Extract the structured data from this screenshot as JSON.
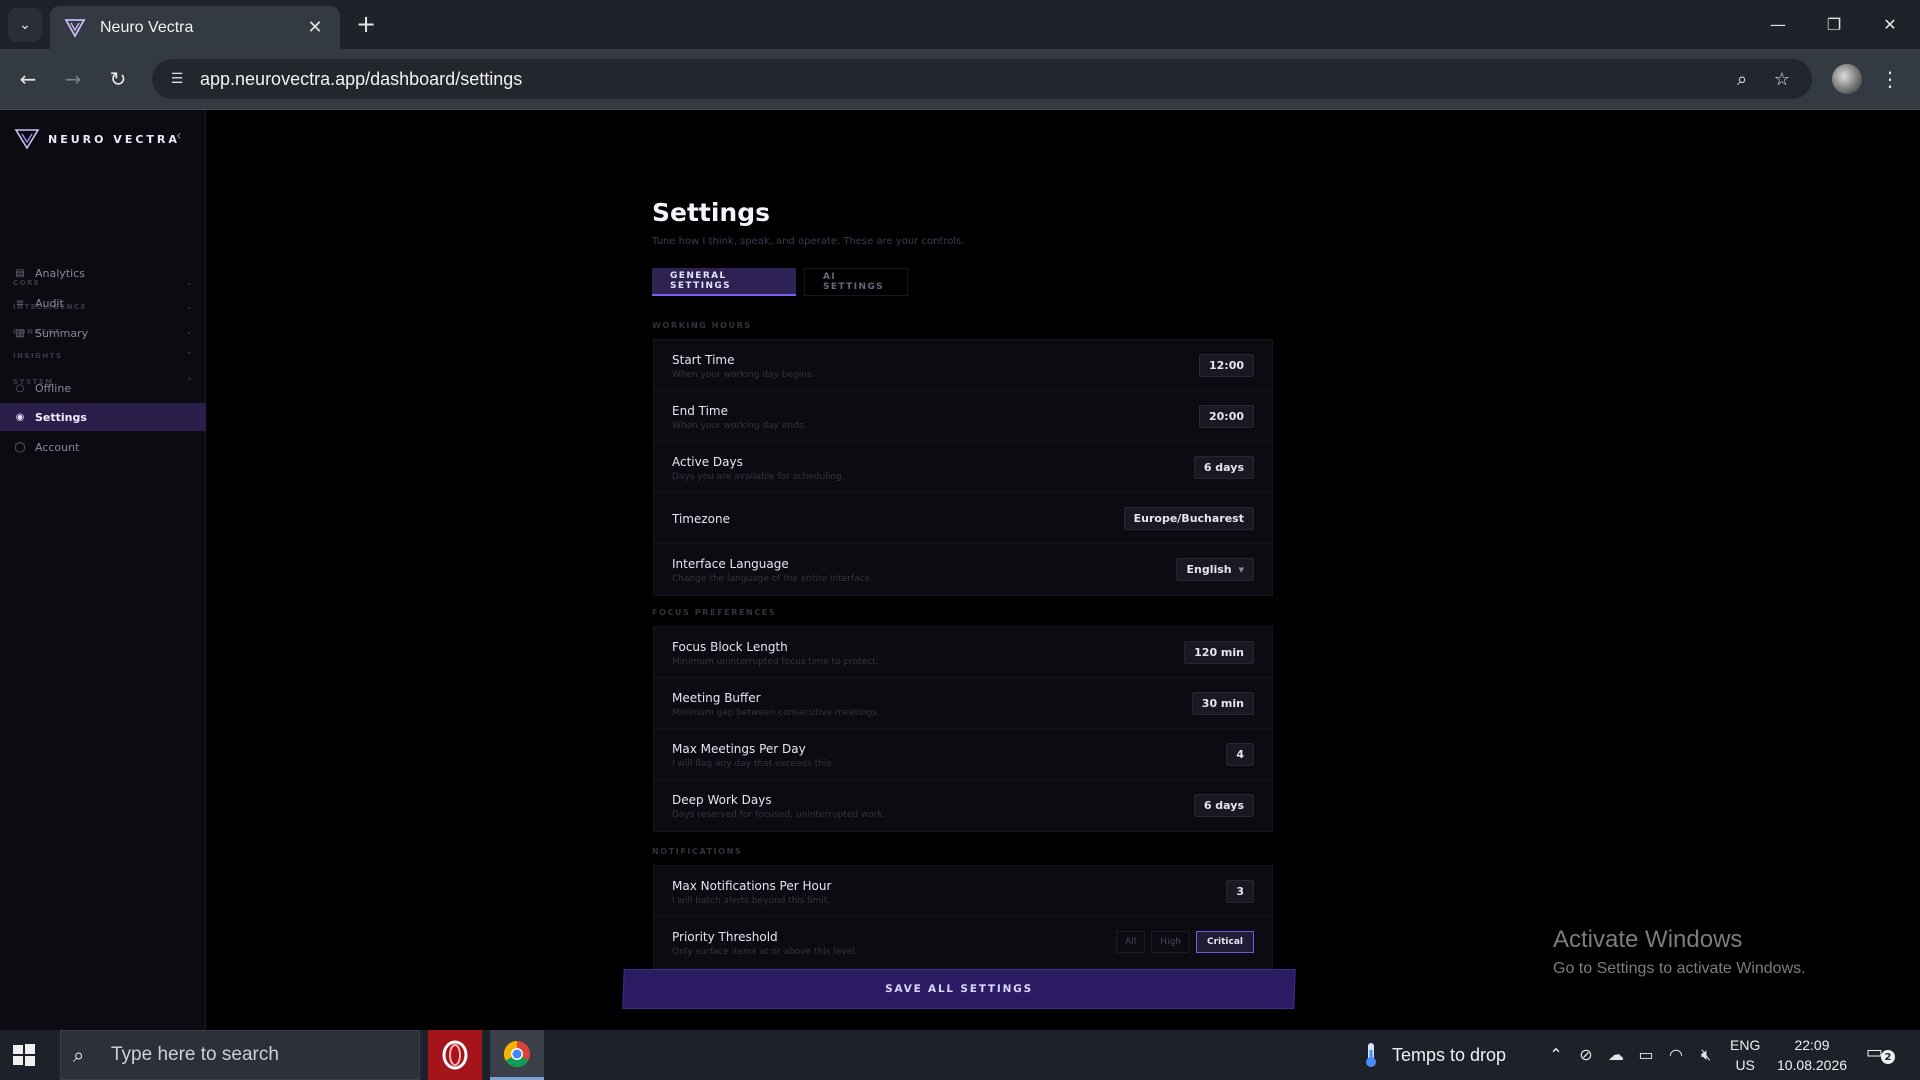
{
  "browser": {
    "tab_title": "Neuro Vectra",
    "url": "app.neurovectra.app/dashboard/settings"
  },
  "sidebar": {
    "brand": "NEURO VECTRA",
    "sections": {
      "core": "CORE",
      "intelligence": "INTELLIGENCE",
      "connect": "CONNECT",
      "insights": "INSIGHTS",
      "system": "SYSTEM"
    },
    "items": {
      "analytics": "Analytics",
      "audit": "Audit",
      "summary": "Summary",
      "offline": "Offline",
      "settings": "Settings",
      "account": "Account"
    }
  },
  "page": {
    "title": "Settings",
    "subtitle": "Tune how I think, speak, and operate. These are your controls.",
    "tabs": {
      "general": "GENERAL SETTINGS",
      "ai": "AI SETTINGS"
    }
  },
  "working_hours": {
    "label": "WORKING HOURS",
    "start_time": {
      "title": "Start Time",
      "desc": "When your working day begins.",
      "value": "12:00"
    },
    "end_time": {
      "title": "End Time",
      "desc": "When your working day ends.",
      "value": "20:00"
    },
    "active_days": {
      "title": "Active Days",
      "desc": "Days you are available for scheduling.",
      "value": "6 days"
    },
    "timezone": {
      "title": "Timezone",
      "value": "Europe/Bucharest"
    },
    "language": {
      "title": "Interface Language",
      "desc": "Change the language of the entire interface.",
      "value": "English"
    }
  },
  "focus": {
    "label": "FOCUS PREFERENCES",
    "block_length": {
      "title": "Focus Block Length",
      "desc": "Minimum uninterrupted focus time to protect.",
      "value": "120 min"
    },
    "meeting_buffer": {
      "title": "Meeting Buffer",
      "desc": "Minimum gap between consecutive meetings.",
      "value": "30 min"
    },
    "max_meetings": {
      "title": "Max Meetings Per Day",
      "desc": "I will flag any day that exceeds this.",
      "value": "4"
    },
    "deep_work": {
      "title": "Deep Work Days",
      "desc": "Days reserved for focused, uninterrupted work.",
      "value": "6 days"
    }
  },
  "notifications": {
    "label": "NOTIFICATIONS",
    "max_per_hour": {
      "title": "Max Notifications Per Hour",
      "desc": "I will batch alerts beyond this limit.",
      "value": "3"
    },
    "priority": {
      "title": "Priority Threshold",
      "desc": "Only surface items at or above this level.",
      "options": {
        "all": "All",
        "high": "High",
        "critical": "Critical"
      }
    }
  },
  "save_button": "SAVE ALL SETTINGS",
  "watermark": {
    "line1": "Activate Windows",
    "line2": "Go to Settings to activate Windows."
  },
  "taskbar": {
    "search_placeholder": "Type here to search",
    "weather": "Temps to drop",
    "lang_top": "ENG",
    "lang_bottom": "US",
    "time": "22:09",
    "date": "10.08.2026",
    "notification_count": "2"
  },
  "colors": {
    "accent": "#7a5cf0",
    "save_bg": "#2a1b63",
    "sidebar_active": "#2a1f4a"
  }
}
